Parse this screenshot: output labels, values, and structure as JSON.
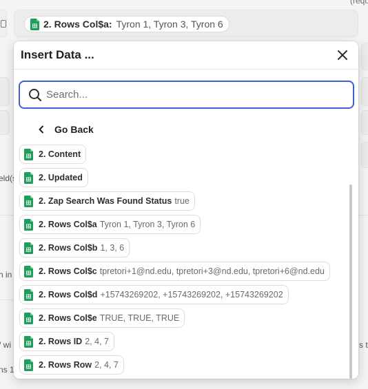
{
  "background": {
    "top_right_text": "(requ",
    "field_pill": {
      "label": "2. Rows Col$a:",
      "value": "Tyron 1, Tyron 3, Tyron 6"
    },
    "left_fragments": [
      "eld(s",
      "h in",
      "/ wi",
      "ns 1"
    ],
    "right_fragments": [
      "s to"
    ]
  },
  "panel": {
    "title": "Insert Data ...",
    "search_placeholder": "Search...",
    "go_back_label": "Go Back",
    "items": [
      {
        "label": "2. Content",
        "value": ""
      },
      {
        "label": "2. Updated",
        "value": ""
      },
      {
        "label": "2. Zap Search Was Found Status",
        "value": "true"
      },
      {
        "label": "2. Rows Col$a",
        "value": "Tyron 1, Tyron 3, Tyron 6"
      },
      {
        "label": "2. Rows Col$b",
        "value": "1, 3, 6"
      },
      {
        "label": "2. Rows Col$c",
        "value": "tpretori+1@nd.edu, tpretori+3@nd.edu, tpretori+6@nd.edu"
      },
      {
        "label": "2. Rows Col$d",
        "value": "+15743269202, +15743269202, +15743269202"
      },
      {
        "label": "2. Rows Col$e",
        "value": "TRUE, TRUE, TRUE"
      },
      {
        "label": "2. Rows ID",
        "value": "2, 4, 7"
      },
      {
        "label": "2. Rows Row",
        "value": "2, 4, 7"
      }
    ]
  },
  "colors": {
    "accent_focus": "#3d5fd4",
    "sheets_green": "#1e9e5a"
  },
  "icons": {
    "app": "google-sheets-icon",
    "close": "close-icon",
    "search": "search-icon",
    "back": "chevron-left-icon"
  }
}
